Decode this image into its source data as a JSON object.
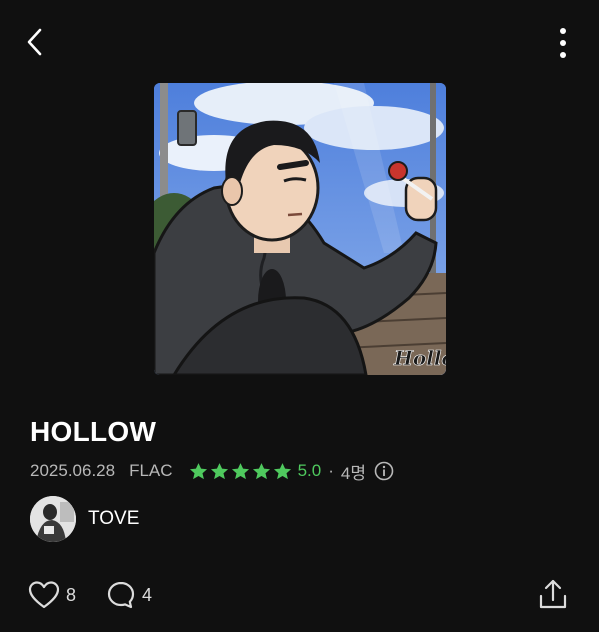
{
  "header": {
    "back_icon": "chevron-left-icon",
    "more_icon": "more-vertical-icon"
  },
  "album": {
    "title": "HOLLOW",
    "release_date": "2025.06.28",
    "format": "FLAC",
    "star_count": 5,
    "rating": "5.0",
    "rating_separator": "·",
    "rater_count": "4명",
    "cover_signature": "Hollow"
  },
  "artist": {
    "name": "TOVE"
  },
  "actions": {
    "likes": "8",
    "comments": "4"
  },
  "colors": {
    "background": "#101010",
    "accent": "#4fc95e",
    "text": "#ffffff",
    "muted": "#b8b8b8"
  }
}
